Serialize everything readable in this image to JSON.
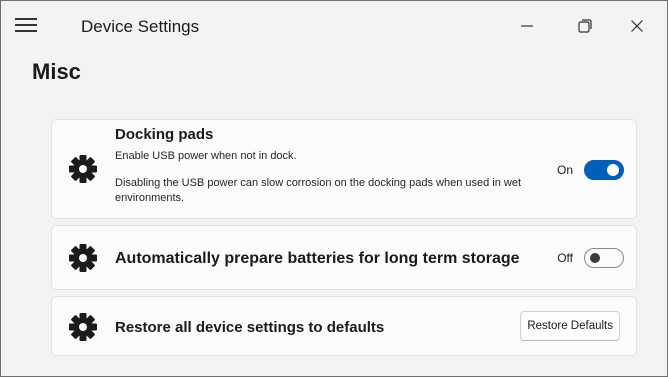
{
  "window": {
    "title": "Device Settings",
    "icons": {
      "menu": "hamburger-menu-icon",
      "minimize": "minimize-icon",
      "maximize": "maximize-icon",
      "close": "close-icon"
    }
  },
  "section": {
    "title": "Misc"
  },
  "settings": [
    {
      "icon": "gear-icon",
      "title": "Docking pads",
      "description": "Enable USB power when not in dock.",
      "detail": "Disabling the USB power can slow corrosion on the docking pads when used in wet environments.",
      "toggle": {
        "label": "On",
        "state": true
      }
    },
    {
      "icon": "gear-icon",
      "title": "Automatically prepare batteries for long term storage",
      "toggle": {
        "label": "Off",
        "state": false
      }
    },
    {
      "icon": "gear-icon",
      "title": "Restore all device settings to defaults",
      "button": {
        "label": "Restore Defaults"
      }
    }
  ],
  "colors": {
    "accent": "#005fb8",
    "background": "#f3f3f3",
    "card": "#fbfbfb"
  }
}
